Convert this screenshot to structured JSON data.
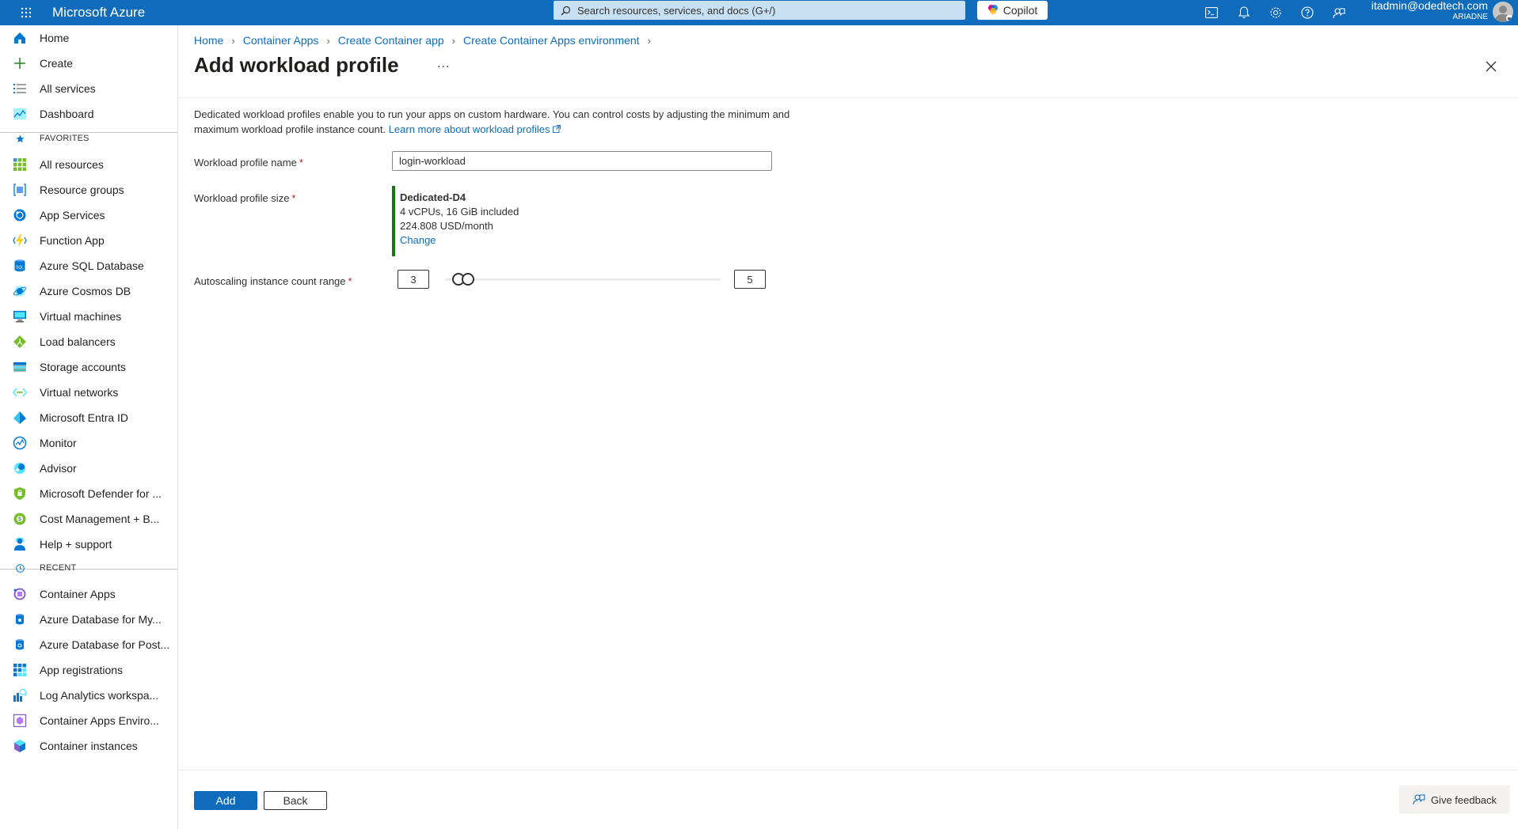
{
  "topbar": {
    "brand": "Microsoft Azure",
    "search_placeholder": "Search resources, services, and docs (G+/)",
    "copilot_label": "Copilot",
    "account_email": "itadmin@odedtech.com",
    "account_tenant": "ARIADNE"
  },
  "sidebar": {
    "top_items": [
      {
        "label": "Home",
        "icon": "home-icon"
      },
      {
        "label": "Create",
        "icon": "plus-icon"
      },
      {
        "label": "All services",
        "icon": "list-icon"
      },
      {
        "label": "Dashboard",
        "icon": "dashboard-icon"
      }
    ],
    "favorites_header": "FAVORITES",
    "favorites": [
      {
        "label": "All resources",
        "icon": "all-resources-icon"
      },
      {
        "label": "Resource groups",
        "icon": "resource-groups-icon"
      },
      {
        "label": "App Services",
        "icon": "app-services-icon"
      },
      {
        "label": "Function App",
        "icon": "function-app-icon"
      },
      {
        "label": "Azure SQL Database",
        "icon": "sql-database-icon"
      },
      {
        "label": "Azure Cosmos DB",
        "icon": "cosmos-db-icon"
      },
      {
        "label": "Virtual machines",
        "icon": "virtual-machines-icon"
      },
      {
        "label": "Load balancers",
        "icon": "load-balancers-icon"
      },
      {
        "label": "Storage accounts",
        "icon": "storage-accounts-icon"
      },
      {
        "label": "Virtual networks",
        "icon": "virtual-networks-icon"
      },
      {
        "label": "Microsoft Entra ID",
        "icon": "entra-id-icon"
      },
      {
        "label": "Monitor",
        "icon": "monitor-icon"
      },
      {
        "label": "Advisor",
        "icon": "advisor-icon"
      },
      {
        "label": "Microsoft Defender for ...",
        "icon": "defender-icon"
      },
      {
        "label": "Cost Management + B...",
        "icon": "cost-management-icon"
      },
      {
        "label": "Help + support",
        "icon": "help-support-icon"
      }
    ],
    "recent_header": "RECENT",
    "recent": [
      {
        "label": "Container Apps",
        "icon": "container-apps-icon"
      },
      {
        "label": "Azure Database for My...",
        "icon": "mysql-icon"
      },
      {
        "label": "Azure Database for Post...",
        "icon": "postgres-icon"
      },
      {
        "label": "App registrations",
        "icon": "app-registrations-icon"
      },
      {
        "label": "Log Analytics workspa...",
        "icon": "log-analytics-icon"
      },
      {
        "label": "Container Apps Enviro...",
        "icon": "container-apps-env-icon"
      },
      {
        "label": "Container instances",
        "icon": "container-instances-icon"
      }
    ]
  },
  "breadcrumb": [
    "Home",
    "Container Apps",
    "Create Container app",
    "Create Container Apps environment"
  ],
  "page": {
    "title": "Add workload profile",
    "more": "...",
    "description": "Dedicated workload profiles enable you to run your apps on custom hardware. You can control costs by adjusting the minimum and maximum workload profile instance count.",
    "learn_more": "Learn more about workload profiles"
  },
  "form": {
    "name_label": "Workload profile name",
    "name_value": "login-workload",
    "size_label": "Workload profile size",
    "size_name": "Dedicated-D4",
    "size_specs": "4 vCPUs, 16 GiB included",
    "size_price": "224.808 USD/month",
    "size_change": "Change",
    "autoscale_label": "Autoscaling instance count range",
    "autoscale_min": "3",
    "autoscale_max": "5",
    "required_marker": "*"
  },
  "footer": {
    "add_label": "Add",
    "back_label": "Back",
    "feedback_label": "Give feedback"
  },
  "colors": {
    "accent": "#0f6cbd",
    "valid_bar": "#107c10",
    "required": "#a4262c"
  }
}
